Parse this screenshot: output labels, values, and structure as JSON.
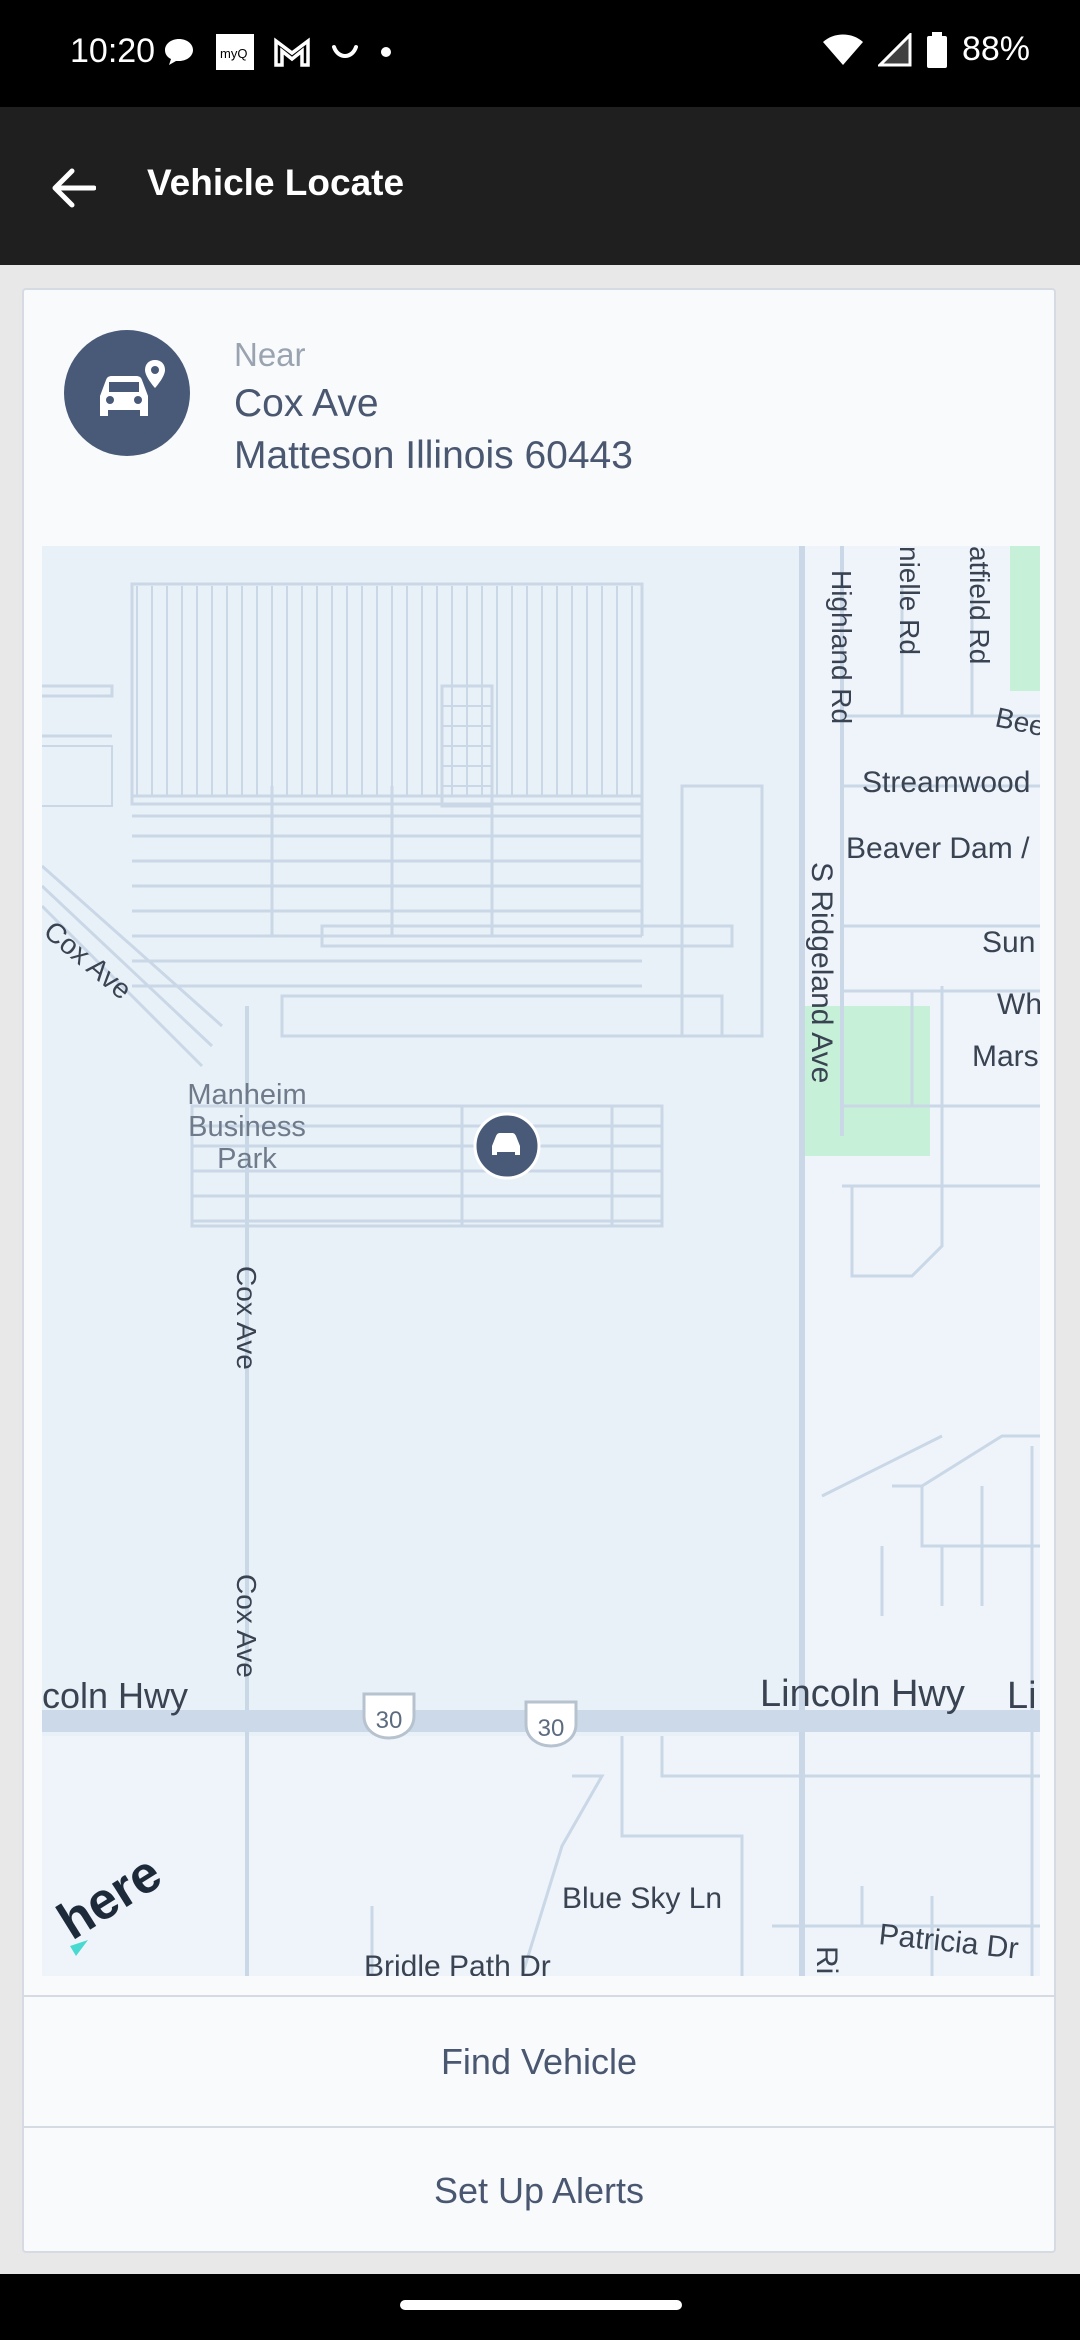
{
  "status_bar": {
    "time": "10:20",
    "battery": "88%",
    "notification_icons": [
      "chat-bubble-icon",
      "myq-icon",
      "gmail-icon",
      "smile-icon",
      "dot-icon"
    ]
  },
  "app_bar": {
    "title": "Vehicle Locate",
    "back_icon": "arrow-left-icon"
  },
  "location": {
    "near_label": "Near",
    "street": "Cox Ave",
    "city": "Matteson Illinois 60443"
  },
  "map": {
    "provider": "here",
    "highway_shield": "30",
    "labels": {
      "cox_ave_diag": "Cox Ave",
      "business_park_1": "Manheim",
      "business_park_2": "Business",
      "business_park_3": "Park",
      "cox_ave_v1": "Cox Ave",
      "cox_ave_v2": "Cox Ave",
      "lincoln_hwy_left": "coln Hwy",
      "lincoln_hwy_right": "Lincoln Hwy",
      "lincoln_hwy_edge": "Li",
      "highland_rd": "Highland Rd",
      "danielle_rd": "nielle Rd",
      "hatfield_rd": "atfield Rd",
      "beech": "Bee",
      "streamwood": "Streamwood",
      "beaver_dam": "Beaver Dam /",
      "ridgeland_ave": "S Ridgeland Ave",
      "sun": "Sun",
      "wh": "Wh",
      "mars": "Mars",
      "blue_sky_ln": "Blue Sky Ln",
      "bridle_path_dr": "Bridle Path Dr",
      "patricia_dr": "Patricia Dr",
      "ri": "Ri"
    }
  },
  "actions": {
    "find_vehicle": "Find Vehicle",
    "set_up_alerts": "Set Up Alerts"
  },
  "colors": {
    "accent": "#495a78",
    "app_bar": "#1f1f1f",
    "map_bg": "#e9f1f8",
    "road": "#c9d7e6",
    "park": "#c6f0d7"
  }
}
